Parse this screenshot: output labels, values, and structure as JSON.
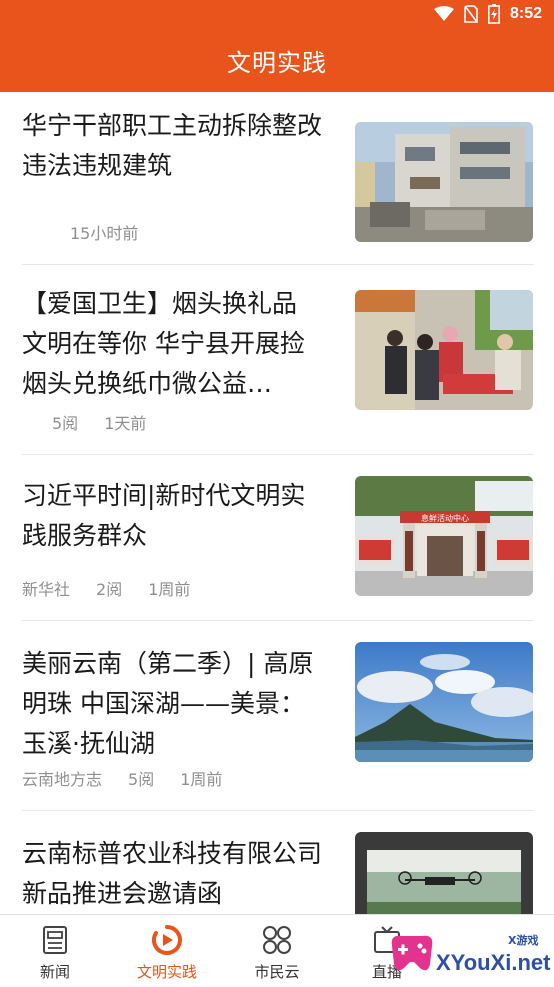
{
  "status_bar": {
    "time": "8:52"
  },
  "header": {
    "title": "文明实践"
  },
  "articles": [
    {
      "title": "华宁干部职工主动拆除整改违法违规建筑",
      "source": "",
      "reads": "",
      "time": "15小时前"
    },
    {
      "title": "【爱国卫生】烟头换礼品 文明在等你 华宁县开展捡烟头兑换纸巾微公益…",
      "source": "",
      "reads": "5阅",
      "time": "1天前"
    },
    {
      "title": "习近平时间|新时代文明实践服务群众",
      "source": "新华社",
      "reads": "2阅",
      "time": "1周前"
    },
    {
      "title": "美丽云南（第二季）| 高原明珠 中国深湖——美景：玉溪·抚仙湖",
      "source": "云南地方志",
      "reads": "5阅",
      "time": "1周前"
    },
    {
      "title": "云南标普农业科技有限公司新品推进会邀请函",
      "source": "",
      "reads": "",
      "time": ""
    }
  ],
  "thumb_sign": "息鲜活动中心",
  "nav": [
    {
      "label": "新闻",
      "icon": "newspaper-icon"
    },
    {
      "label": "文明实践",
      "icon": "play-circle-icon",
      "active": true
    },
    {
      "label": "市民云",
      "icon": "grid-icon"
    },
    {
      "label": "直播",
      "icon": "tv-icon"
    }
  ],
  "watermark": {
    "text": "XYouXi.net",
    "small": "X游戏"
  },
  "colors": {
    "brand": "#e8541c",
    "text": "#1a1a1a",
    "meta": "#8f8f8f"
  }
}
